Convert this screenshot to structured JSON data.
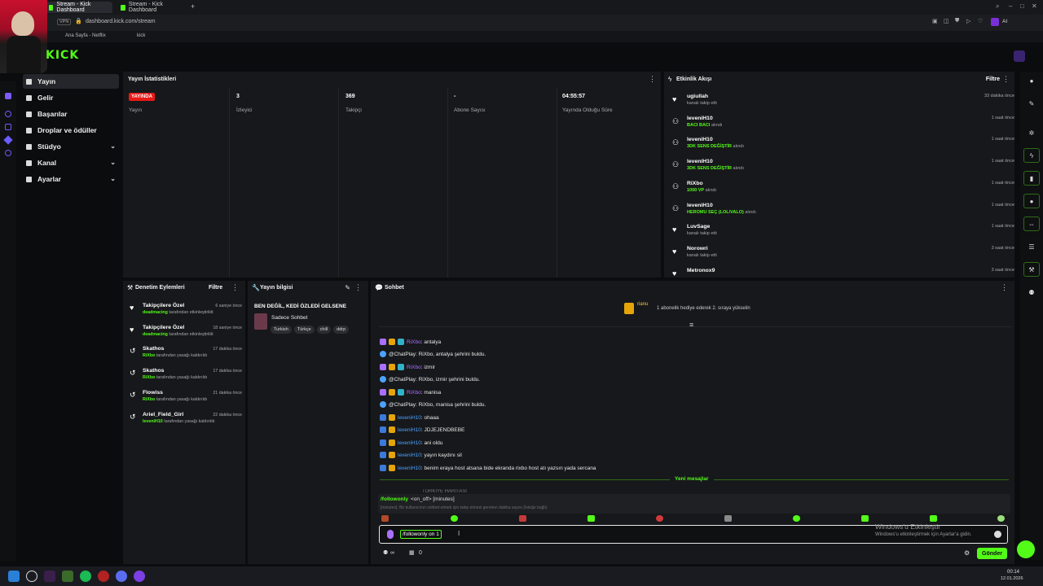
{
  "browser": {
    "tabs": [
      {
        "label": "Stream - Kick Dashboard"
      },
      {
        "label": "Stream - Kick Dashboard"
      }
    ],
    "vpn_label": "VPN",
    "url": "dashboard.kick.com/stream",
    "bookmarks": [
      "Ana Sayfa - Netflix",
      "kick"
    ],
    "ai_label": "AI"
  },
  "logo": "KICK",
  "sidebar": {
    "items": [
      {
        "label": "Yayın",
        "icon": "broadcast-icon"
      },
      {
        "label": "Gelir",
        "icon": "money-icon"
      },
      {
        "label": "Başarılar",
        "icon": "trophy-icon"
      },
      {
        "label": "Droplar ve ödüller",
        "icon": "gift-icon"
      },
      {
        "label": "Stüdyo",
        "icon": "studio-icon"
      },
      {
        "label": "Kanal",
        "icon": "channel-icon"
      },
      {
        "label": "Ayarlar",
        "icon": "gear-icon"
      }
    ]
  },
  "stats": {
    "title": "Yayın İstatistikleri",
    "live_badge": "YAYINDA",
    "live_label": "Yayın",
    "viewers_value": "3",
    "viewers_label": "İzleyici",
    "followers_value": "369",
    "followers_label": "Takipçi",
    "subs_value": "-",
    "subs_label": "Abone Sayısı",
    "uptime_value": "04:55:57",
    "uptime_label": "Yayında Olduğu Süre"
  },
  "activity": {
    "title": "Etkinlik Akışı",
    "filter": "Filtre",
    "items": [
      {
        "name": "ugiullah",
        "sub": "kanalı takip etti",
        "highlight": "",
        "time": "33 dakika önce",
        "icon": "heart-icon"
      },
      {
        "name": "leveniH10",
        "sub": "alındı",
        "highlight": "BACI BACI",
        "time": "1 saat önce",
        "icon": "reward-icon"
      },
      {
        "name": "leveniH10",
        "sub": "alındı",
        "highlight": "3DK SENS DEĞİŞTİR",
        "time": "1 saat önce",
        "icon": "reward-icon"
      },
      {
        "name": "leveniH10",
        "sub": "alındı",
        "highlight": "3DK SENS DEĞİŞTİR",
        "time": "1 saat önce",
        "icon": "reward-icon"
      },
      {
        "name": "RiXbo",
        "sub": "alındı",
        "highlight": "1000 VP",
        "time": "1 saat önce",
        "icon": "reward-icon"
      },
      {
        "name": "leveniH10",
        "sub": "alındı",
        "highlight": "HEROMU SEÇ (LOL/VALO)",
        "time": "1 saat önce",
        "icon": "reward-icon"
      },
      {
        "name": "LuvSage",
        "sub": "kanalı takip etti",
        "highlight": "",
        "time": "1 saat önce",
        "icon": "heart-icon"
      },
      {
        "name": "Norowri",
        "sub": "kanalı takip etti",
        "highlight": "",
        "time": "3 saat önce",
        "icon": "heart-icon"
      },
      {
        "name": "Metronox9",
        "sub": "",
        "highlight": "",
        "time": "3 saat önce",
        "icon": "heart-icon"
      }
    ]
  },
  "moderation": {
    "title": "Denetim Eylemleri",
    "filter": "Filtre",
    "items": [
      {
        "name": "Takipçilere Özel",
        "actor": "deadmacing",
        "sub": "tarafından etkinleştirildi",
        "time": "6 saniye önce",
        "icon": "heart-icon"
      },
      {
        "name": "Takipçilere Özel",
        "actor": "deadmacing",
        "sub": "tarafından etkinleştirildi",
        "time": "18 saniye önce",
        "icon": "heart-icon"
      },
      {
        "name": "Skathos",
        "actor": "RiXbo",
        "sub": "tarafından yasağı kaldırıldı",
        "time": "17 dakika önce",
        "icon": "undo-icon"
      },
      {
        "name": "Skathos",
        "actor": "RiXbo",
        "sub": "tarafından yasağı kaldırıldı",
        "time": "17 dakika önce",
        "icon": "undo-icon"
      },
      {
        "name": "Flowiss",
        "actor": "RiXbo",
        "sub": "tarafından yasağı kaldırıldı",
        "time": "21 dakika önce",
        "icon": "undo-icon"
      },
      {
        "name": "Ariel_Field_Girl",
        "actor": "leveniH10",
        "sub": "tarafından yasağı kaldırıldı",
        "time": "22 dakika önce",
        "icon": "undo-icon"
      }
    ]
  },
  "stream_info": {
    "title": "Yayın bilgisi",
    "stream_title": "BEN DEĞİL, KEDİ ÖZLEDİ GELSENE",
    "category": "Sadece Sohbet",
    "tags": [
      "Turkish",
      "Türkçe",
      "chill",
      "ddrp"
    ]
  },
  "chat": {
    "title": "Sohbet",
    "pinned_user": "rianu",
    "pinned_text": "1 abonelik hediye ederek 2. sıraya yükselin",
    "messages": [
      {
        "user": "RiXbo",
        "text": ": antalya",
        "user_color": "#a970ff"
      },
      {
        "user": "@ChatPlay",
        "text": ": RiXbo, antalya şehrini buldu.",
        "user_color": "#e8e8e8"
      },
      {
        "user": "RiXbo",
        "text": ": izmir",
        "user_color": "#a970ff"
      },
      {
        "user": "@ChatPlay",
        "text": ": RiXbo, izmir şehrini buldu.",
        "user_color": "#e8e8e8"
      },
      {
        "user": "RiXbo",
        "text": ": manisa",
        "user_color": "#a970ff"
      },
      {
        "user": "@ChatPlay",
        "text": ": RiXbo, manisa şehrini buldu.",
        "user_color": "#e8e8e8"
      },
      {
        "user": "leveniH10",
        "text": ": ohaaa",
        "user_color": "#4aa3ff"
      },
      {
        "user": "leveniH10",
        "text": ": JDJEJENDBEBE",
        "user_color": "#4aa3ff"
      },
      {
        "user": "leveniH10",
        "text": ": ani oldu",
        "user_color": "#4aa3ff"
      },
      {
        "user": "leveniH10",
        "text": ": yayın kaydını sil",
        "user_color": "#4aa3ff"
      },
      {
        "user": "leveniH10",
        "text": ": benim eraya host atsana bide ekranda rixbo host atı yazsın yada sercana",
        "user_color": "#4aa3ff"
      }
    ],
    "new_messages": "Yeni mesajlar",
    "partial_line": "TÜRKİYE HARİTASI",
    "cmd_name": "/followonly",
    "cmd_args": "<on_off> [minutes]",
    "cmd_desc": "[minutes]: Bir kullanıcının sohbet etmek için takip etmesi gereken dakika sayısı (İsteğe bağlı)",
    "input_value": "/followonly on 1",
    "watermark_title": "Windows'u Etkinleştir",
    "watermark_sub": "Windows'u etkinleştirmek için Ayarlar'a gidin.",
    "send": "Gönder",
    "counter_a": "∞",
    "counter_b": "0"
  },
  "taskbar": {
    "time": "00:14",
    "date": "12.01.2026"
  },
  "colors": {
    "accent": "#53fc18",
    "live": "#e91916",
    "panel": "#17181b",
    "bg": "#0b0c0e"
  }
}
